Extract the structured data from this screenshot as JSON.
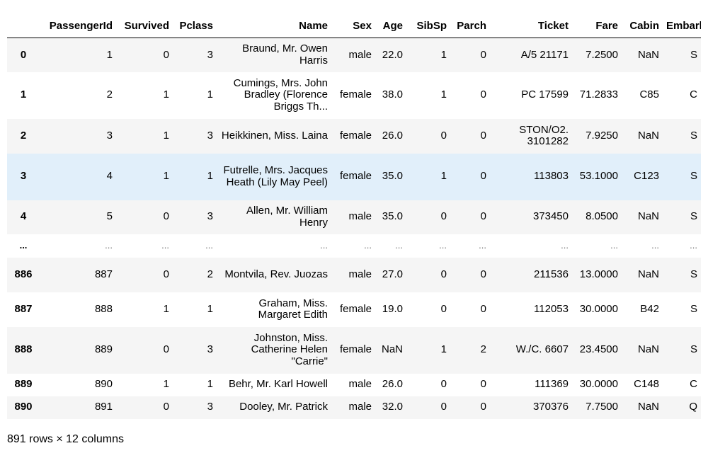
{
  "table": {
    "columns": [
      "",
      "PassengerId",
      "Survived",
      "Pclass",
      "Name",
      "Sex",
      "Age",
      "SibSp",
      "Parch",
      "Ticket",
      "Fare",
      "Cabin",
      "Embarked"
    ],
    "rows": [
      {
        "index": "0",
        "cells": [
          "1",
          "0",
          "3",
          "Braund, Mr. Owen Harris",
          "male",
          "22.0",
          "1",
          "0",
          "A/5 21171",
          "7.2500",
          "NaN",
          "S"
        ]
      },
      {
        "index": "1",
        "cells": [
          "2",
          "1",
          "1",
          "Cumings, Mrs. John Bradley (Florence Briggs Th...",
          "female",
          "38.0",
          "1",
          "0",
          "PC 17599",
          "71.2833",
          "C85",
          "C"
        ]
      },
      {
        "index": "2",
        "cells": [
          "3",
          "1",
          "3",
          "Heikkinen, Miss. Laina",
          "female",
          "26.0",
          "0",
          "0",
          "STON/O2. 3101282",
          "7.9250",
          "NaN",
          "S"
        ]
      },
      {
        "index": "3",
        "cells": [
          "4",
          "1",
          "1",
          "Futrelle, Mrs. Jacques Heath (Lily May Peel)",
          "female",
          "35.0",
          "1",
          "0",
          "113803",
          "53.1000",
          "C123",
          "S"
        ],
        "highlighted": true
      },
      {
        "index": "4",
        "cells": [
          "5",
          "0",
          "3",
          "Allen, Mr. William Henry",
          "male",
          "35.0",
          "0",
          "0",
          "373450",
          "8.0500",
          "NaN",
          "S"
        ]
      },
      {
        "index": "...",
        "cells": [
          "...",
          "...",
          "...",
          "...",
          "...",
          "...",
          "...",
          "...",
          "...",
          "...",
          "...",
          "..."
        ]
      },
      {
        "index": "886",
        "cells": [
          "887",
          "0",
          "2",
          "Montvila, Rev. Juozas",
          "male",
          "27.0",
          "0",
          "0",
          "211536",
          "13.0000",
          "NaN",
          "S"
        ]
      },
      {
        "index": "887",
        "cells": [
          "888",
          "1",
          "1",
          "Graham, Miss. Margaret Edith",
          "female",
          "19.0",
          "0",
          "0",
          "112053",
          "30.0000",
          "B42",
          "S"
        ]
      },
      {
        "index": "888",
        "cells": [
          "889",
          "0",
          "3",
          "Johnston, Miss. Catherine Helen \"Carrie\"",
          "female",
          "NaN",
          "1",
          "2",
          "W./C. 6607",
          "23.4500",
          "NaN",
          "S"
        ]
      },
      {
        "index": "889",
        "cells": [
          "890",
          "1",
          "1",
          "Behr, Mr. Karl Howell",
          "male",
          "26.0",
          "0",
          "0",
          "111369",
          "30.0000",
          "C148",
          "C"
        ]
      },
      {
        "index": "890",
        "cells": [
          "891",
          "0",
          "3",
          "Dooley, Mr. Patrick",
          "male",
          "32.0",
          "0",
          "0",
          "370376",
          "7.7500",
          "NaN",
          "Q"
        ]
      }
    ]
  },
  "footer": {
    "shape_text": "891 rows × 12 columns"
  }
}
